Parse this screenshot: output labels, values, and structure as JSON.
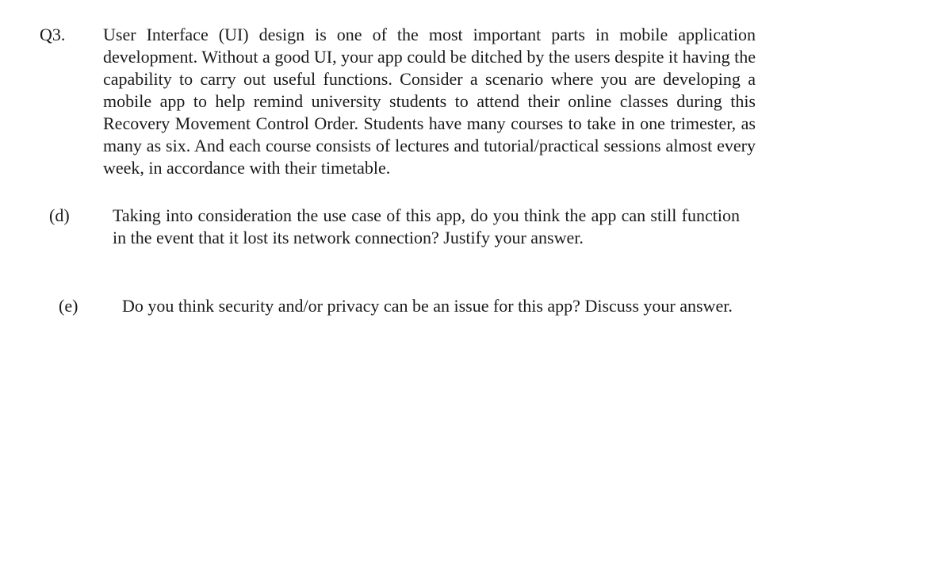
{
  "question": {
    "number": "Q3.",
    "intro": "User Interface (UI) design is one of the most important parts in mobile application development. Without a good UI, your app could be ditched by the users despite it having the capability to carry out useful functions. Consider a scenario where you are developing a mobile app to help remind university students to attend their online classes during this Recovery Movement Control Order. Students have many courses to take in one trimester, as many as six. And each course consists of lectures and tutorial/practical sessions almost every week, in accordance with their timetable."
  },
  "parts": [
    {
      "label": "(d)",
      "text": "Taking into consideration the use case of this app, do you think the app can still function in the event that it lost its network connection? Justify your answer."
    },
    {
      "label": "(e)",
      "text": "Do you think security and/or privacy can be an issue for this app? Discuss your answer."
    }
  ]
}
